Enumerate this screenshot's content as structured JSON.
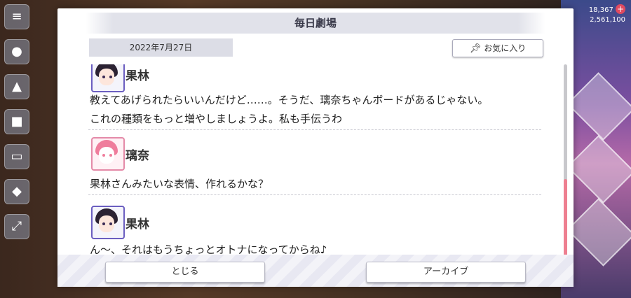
{
  "dialog": {
    "title": "毎日劇場",
    "date": "2022年7月27日",
    "favorite_label": "お気に入り"
  },
  "log": [
    {
      "speaker": "果林",
      "avatar": "karin-avatar",
      "lines": [
        "教えてあげられたらいいんだけど……。そうだ、璃奈ちゃんボードがあるじゃない。",
        "これの種類をもっと増やしましょうよ。私も手伝うわ"
      ]
    },
    {
      "speaker": "璃奈",
      "avatar": "rina-avatar",
      "lines": [
        "果林さんみたいな表情、作れるかな？"
      ]
    },
    {
      "speaker": "果林",
      "avatar": "karin-avatar",
      "lines": [
        "ん～、それはもうちょっとオトナになってからね♪"
      ]
    }
  ],
  "buttons": {
    "close": "とじる",
    "archive": "アーカイブ"
  },
  "background": {
    "counter_top": "18,367",
    "counter_bottom": "2,561,100",
    "plus": "+"
  },
  "colors": {
    "accent_scroll": "#ee7f90",
    "karin_frame": "#6b5ec0",
    "rina_frame": "#e48aa8"
  }
}
